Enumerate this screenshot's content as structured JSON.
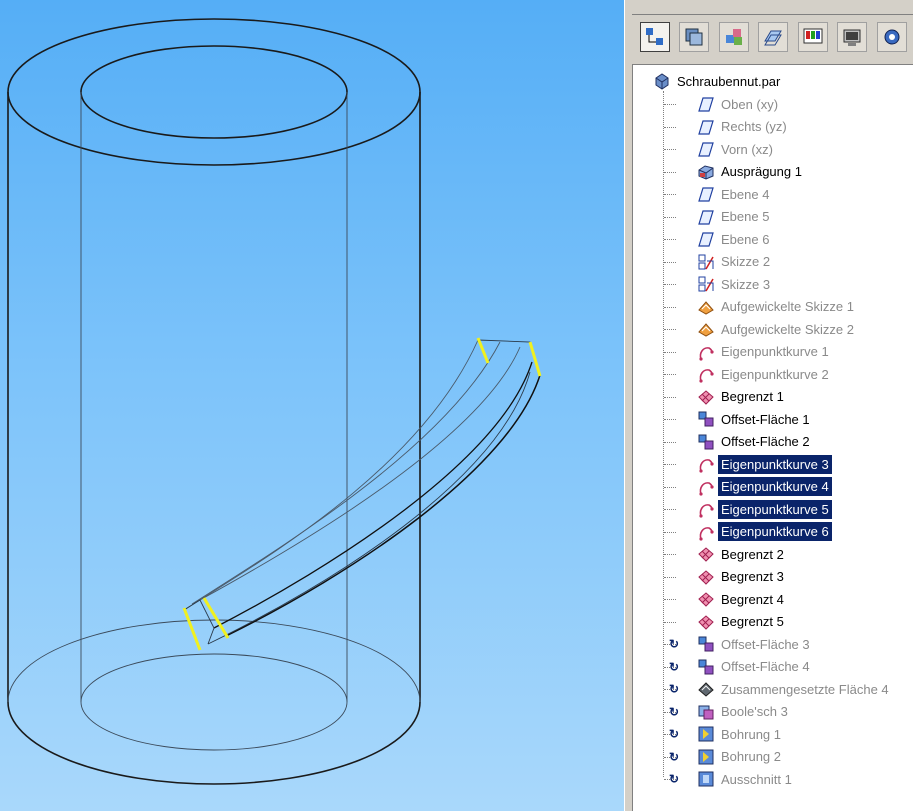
{
  "toolbar": {
    "buttons": [
      {
        "name": "feature-pathfinder-icon"
      },
      {
        "name": "layers-icon"
      },
      {
        "name": "assembly-icon"
      },
      {
        "name": "planes-icon"
      },
      {
        "name": "colors-icon"
      },
      {
        "name": "render-icon"
      },
      {
        "name": "settings-icon"
      }
    ]
  },
  "tree": {
    "root": "Schraubennut.par",
    "items": [
      {
        "label": "Oben (xy)",
        "icon": "plane-icon",
        "state": "dim"
      },
      {
        "label": "Rechts (yz)",
        "icon": "plane-icon",
        "state": "dim"
      },
      {
        "label": "Vorn (xz)",
        "icon": "plane-icon",
        "state": "dim"
      },
      {
        "label": "Ausprägung 1",
        "icon": "extrude-icon",
        "state": "normal"
      },
      {
        "label": "Ebene 4",
        "icon": "plane-icon",
        "state": "dim"
      },
      {
        "label": "Ebene 5",
        "icon": "plane-icon",
        "state": "dim"
      },
      {
        "label": "Ebene 6",
        "icon": "plane-icon",
        "state": "dim"
      },
      {
        "label": "Skizze 2",
        "icon": "sketch-icon",
        "state": "dim"
      },
      {
        "label": "Skizze 3",
        "icon": "sketch-icon",
        "state": "dim"
      },
      {
        "label": "Aufgewickelte Skizze 1",
        "icon": "wrapped-sketch-icon",
        "state": "dim"
      },
      {
        "label": "Aufgewickelte Skizze 2",
        "icon": "wrapped-sketch-icon",
        "state": "dim"
      },
      {
        "label": "Eigenpunktkurve 1",
        "icon": "keypoint-curve-icon",
        "state": "dim"
      },
      {
        "label": "Eigenpunktkurve 2",
        "icon": "keypoint-curve-icon",
        "state": "dim"
      },
      {
        "label": "Begrenzt 1",
        "icon": "bounded-surface-icon",
        "state": "normal"
      },
      {
        "label": "Offset-Fläche 1",
        "icon": "offset-surface-icon",
        "state": "normal"
      },
      {
        "label": "Offset-Fläche 2",
        "icon": "offset-surface-icon",
        "state": "normal"
      },
      {
        "label": "Eigenpunktkurve 3",
        "icon": "keypoint-curve-icon",
        "state": "sel"
      },
      {
        "label": "Eigenpunktkurve 4",
        "icon": "keypoint-curve-icon",
        "state": "sel"
      },
      {
        "label": "Eigenpunktkurve 5",
        "icon": "keypoint-curve-icon",
        "state": "sel"
      },
      {
        "label": "Eigenpunktkurve 6",
        "icon": "keypoint-curve-icon",
        "state": "sel"
      },
      {
        "label": "Begrenzt 2",
        "icon": "bounded-surface-icon",
        "state": "normal"
      },
      {
        "label": "Begrenzt 3",
        "icon": "bounded-surface-icon",
        "state": "normal"
      },
      {
        "label": "Begrenzt 4",
        "icon": "bounded-surface-icon",
        "state": "normal"
      },
      {
        "label": "Begrenzt 5",
        "icon": "bounded-surface-icon",
        "state": "normal"
      },
      {
        "label": "Offset-Fläche 3",
        "icon": "offset-surface-icon",
        "state": "dim",
        "rollback": true
      },
      {
        "label": "Offset-Fläche 4",
        "icon": "offset-surface-icon",
        "state": "dim",
        "rollback": true
      },
      {
        "label": "Zusammengesetzte Fläche 4",
        "icon": "stitched-surface-icon",
        "state": "dim",
        "rollback": true
      },
      {
        "label": "Boole'sch 3",
        "icon": "boolean-icon",
        "state": "dim",
        "rollback": true
      },
      {
        "label": "Bohrung 1",
        "icon": "hole-icon",
        "state": "dim",
        "rollback": true
      },
      {
        "label": "Bohrung 2",
        "icon": "hole-icon",
        "state": "dim",
        "rollback": true
      },
      {
        "label": "Ausschnitt 1",
        "icon": "cutout-icon",
        "state": "dim",
        "rollback": true
      }
    ]
  },
  "colors": {
    "viewport_top": "#55aef6",
    "viewport_bottom": "#a9d8fb",
    "selection": "#0a246a",
    "highlight_edges": "#f0f020"
  }
}
